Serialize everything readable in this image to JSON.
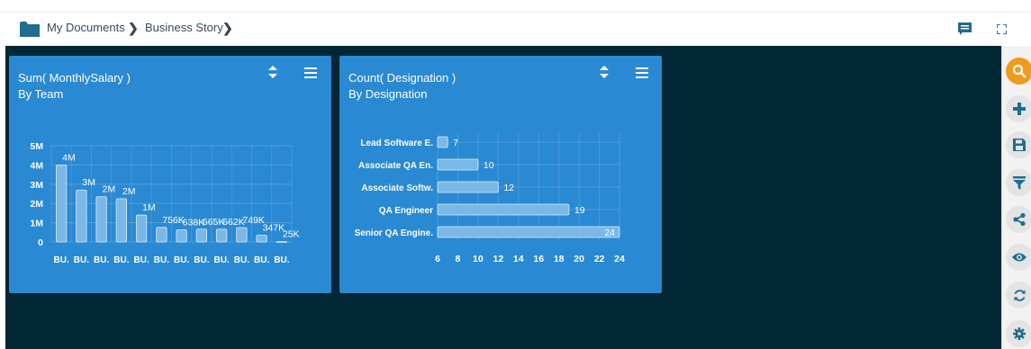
{
  "breadcrumb": {
    "items": [
      "My Documents",
      "Business Story"
    ]
  },
  "header": {
    "icons": [
      "comment-icon",
      "fullscreen-icon"
    ]
  },
  "colors": {
    "canvas": "#022836",
    "panel": "#2a89d3",
    "bar_fill": "#7ab8e8",
    "accent": "#f29a1b"
  },
  "panels": [
    {
      "title": "Sum( MonthlySalary )",
      "subtitle": "By Team",
      "chart_data": {
        "type": "bar",
        "categories": [
          "BU.",
          "BU.",
          "BU.",
          "BU.",
          "BU.",
          "BU.",
          "BU.",
          "BU.",
          "BU.",
          "BU.",
          "BU.",
          "BU."
        ],
        "values": [
          4000000,
          2700000,
          2350000,
          2250000,
          1400000,
          756000,
          638000,
          665000,
          662000,
          749000,
          347000,
          25000
        ],
        "data_labels": [
          "4M",
          "3M",
          "2M",
          "2M",
          "1M",
          "756K",
          "638K",
          "665K",
          "662K",
          "749K",
          "347K",
          "25K"
        ],
        "ylim": [
          0,
          5000000
        ],
        "yticks": [
          "0",
          "1M",
          "2M",
          "3M",
          "4M",
          "5M"
        ],
        "grid": true
      }
    },
    {
      "title": "Count( Designation )",
      "subtitle": "By Designation",
      "chart_data": {
        "type": "bar",
        "orientation": "horizontal",
        "categories": [
          "Lead Software E.",
          "Associate QA En.",
          "Associate Softw.",
          "QA Engineer",
          "Senior QA Engine."
        ],
        "values": [
          7,
          10,
          12,
          19,
          24
        ],
        "xlim": [
          6,
          24
        ],
        "xticks": [
          "6",
          "8",
          "10",
          "12",
          "14",
          "16",
          "18",
          "20",
          "22",
          "24"
        ],
        "grid": true
      }
    }
  ],
  "toolbar": {
    "buttons": [
      {
        "icon": "search-icon",
        "active": true
      },
      {
        "icon": "plus-icon"
      },
      {
        "icon": "save-icon"
      },
      {
        "icon": "filter-icon"
      },
      {
        "icon": "share-icon"
      },
      {
        "icon": "eye-icon"
      },
      {
        "icon": "refresh-icon"
      },
      {
        "icon": "gear-icon"
      }
    ]
  }
}
